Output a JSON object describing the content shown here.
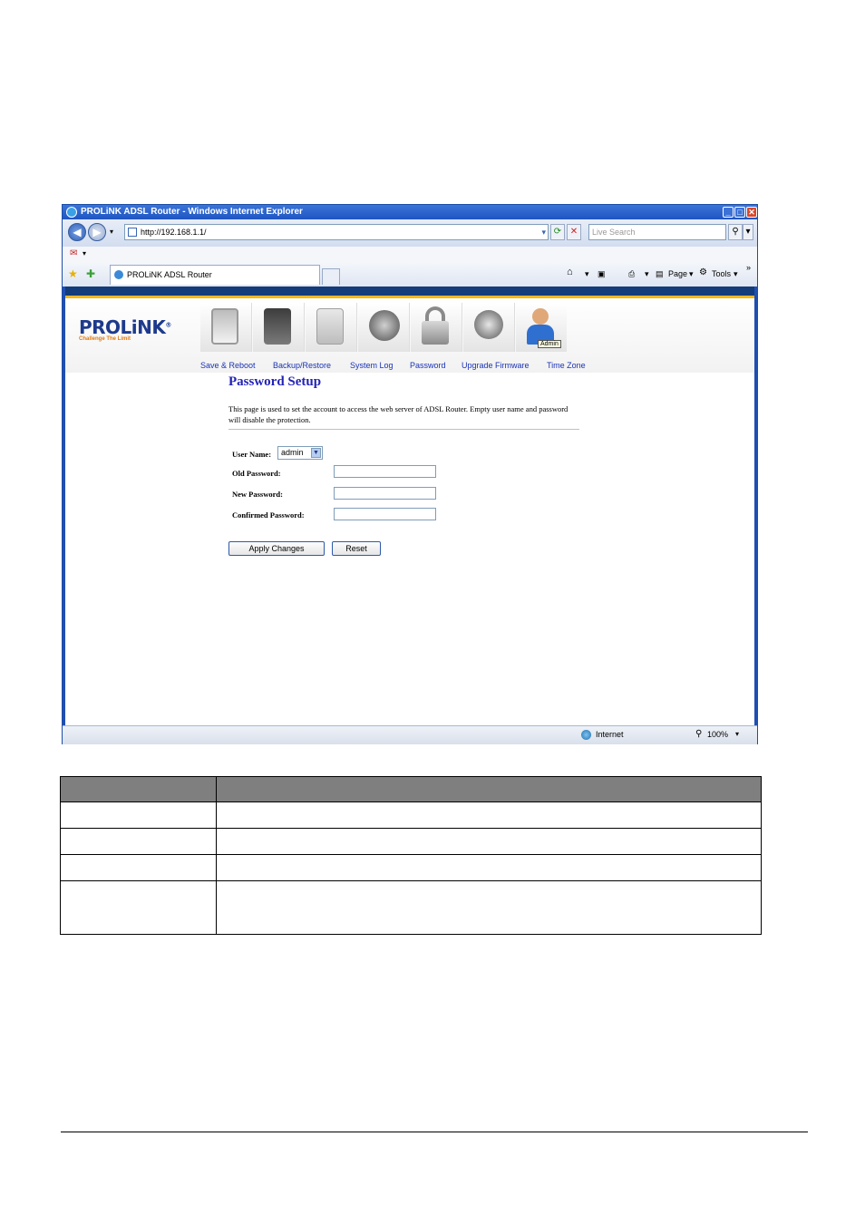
{
  "browser": {
    "window_title": "PROLiNK ADSL Router - Windows Internet Explorer",
    "address": "http://192.168.1.1/",
    "search_placeholder": "Live Search",
    "tab_title": "PROLiNK ADSL Router",
    "toolbar": {
      "page_label": "Page",
      "tools_label": "Tools",
      "overflow": "»"
    },
    "status": {
      "zone": "Internet",
      "zoom": "100%"
    }
  },
  "router": {
    "logo": "PROLiNK",
    "logo_mark": "®",
    "tagline": "Challenge The Limit",
    "admin_tooltip": "Admin",
    "nav": [
      {
        "label": "Save & Reboot",
        "icon": "monitor-icon"
      },
      {
        "label": "Backup/Restore",
        "icon": "gear-tower-icon"
      },
      {
        "label": "System Log",
        "icon": "server-icon"
      },
      {
        "label": "Password",
        "icon": "globe-icon"
      },
      {
        "label": "Upgrade Firmware",
        "icon": "padlock-icon"
      },
      {
        "label": "Time Zone",
        "icon": "globe-monitor-icon"
      }
    ],
    "page_title": "Password Setup",
    "description": "This page is used to set the account to access the web server of ADSL Router. Empty user name and password will disable the protection.",
    "form": {
      "user_name_label": "User Name:",
      "user_name_value": "admin",
      "old_password_label": "Old Password:",
      "new_password_label": "New Password:",
      "confirm_password_label": "Confirmed Password:",
      "apply_button": "Apply Changes",
      "reset_button": "Reset"
    }
  },
  "colors": {
    "title_blue": "#2323b8",
    "nav_link": "#1a33b5",
    "header_stripe": "#133c7a",
    "accent_gold": "#f0b820",
    "table_header": "#7f7f7f"
  }
}
